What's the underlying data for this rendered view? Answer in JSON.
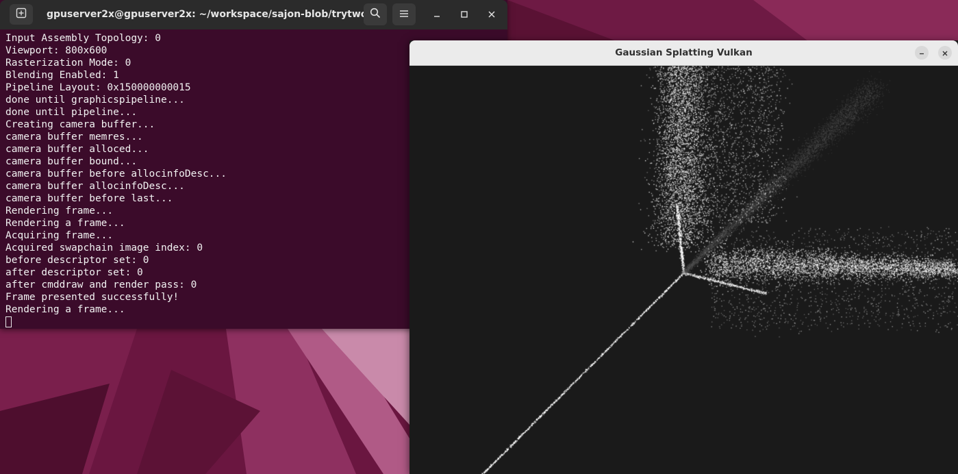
{
  "desktop": {
    "colors": {
      "base": "#5a1234",
      "dark": "#3d0a24",
      "light": "#9a3a6a"
    }
  },
  "terminal": {
    "title": "gpuserver2x@gpuserver2x: ~/workspace/sajon-blob/trytwo/...",
    "icons": {
      "new_tab": "new-tab-icon",
      "search": "search-icon",
      "menu": "hamburger-menu-icon",
      "minimize": "minimize-icon",
      "maximize": "maximize-icon",
      "close": "close-icon"
    },
    "background": "#3b0b2a",
    "lines": [
      "Input Assembly Topology: 0",
      "Viewport: 800x600",
      "Rasterization Mode: 0",
      "Blending Enabled: 1",
      "Pipeline Layout: 0x150000000015",
      "done until graphicspipeline...",
      "done until pipeline...",
      "Creating camera buffer...",
      "camera buffer memres...",
      "camera buffer alloced...",
      "camera buffer bound...",
      "camera buffer before allocinfoDesc...",
      "camera buffer allocinfoDesc...",
      "camera buffer before last...",
      "Rendering frame...",
      "Rendering a frame...",
      "Acquiring frame...",
      "Acquired swapchain image index: 0",
      "before descriptor set: 0",
      "after descriptor set: 0",
      "after cmddraw and render pass: 0",
      "Frame presented successfully!",
      "Rendering a frame..."
    ]
  },
  "vulkan_window": {
    "title": "Gaussian Splatting Vulkan",
    "icons": {
      "minimize": "minimize-icon",
      "close": "close-icon"
    },
    "background": "#1a1a1a",
    "point_color": "#ffffff"
  }
}
